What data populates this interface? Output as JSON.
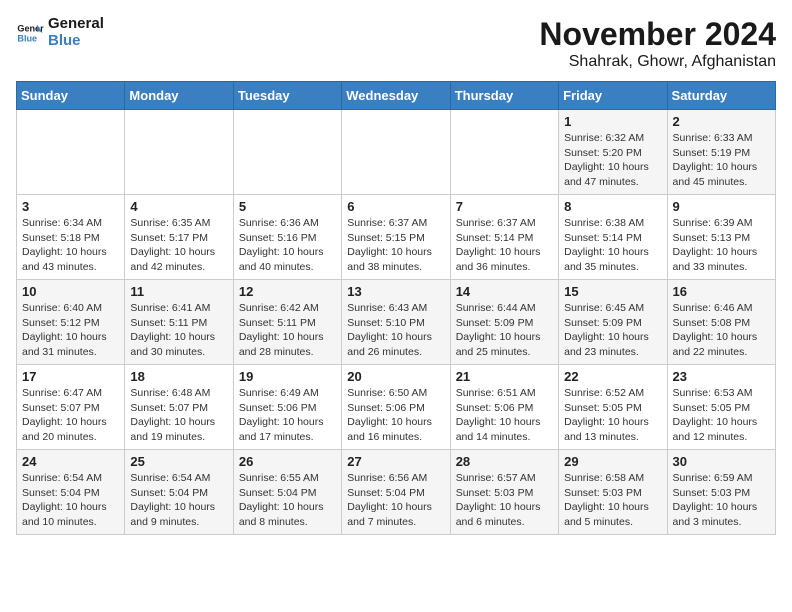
{
  "logo": {
    "line1": "General",
    "line2": "Blue"
  },
  "title": "November 2024",
  "subtitle": "Shahrak, Ghowr, Afghanistan",
  "days_of_week": [
    "Sunday",
    "Monday",
    "Tuesday",
    "Wednesday",
    "Thursday",
    "Friday",
    "Saturday"
  ],
  "weeks": [
    [
      {
        "day": "",
        "info": ""
      },
      {
        "day": "",
        "info": ""
      },
      {
        "day": "",
        "info": ""
      },
      {
        "day": "",
        "info": ""
      },
      {
        "day": "",
        "info": ""
      },
      {
        "day": "1",
        "info": "Sunrise: 6:32 AM\nSunset: 5:20 PM\nDaylight: 10 hours and 47 minutes."
      },
      {
        "day": "2",
        "info": "Sunrise: 6:33 AM\nSunset: 5:19 PM\nDaylight: 10 hours and 45 minutes."
      }
    ],
    [
      {
        "day": "3",
        "info": "Sunrise: 6:34 AM\nSunset: 5:18 PM\nDaylight: 10 hours and 43 minutes."
      },
      {
        "day": "4",
        "info": "Sunrise: 6:35 AM\nSunset: 5:17 PM\nDaylight: 10 hours and 42 minutes."
      },
      {
        "day": "5",
        "info": "Sunrise: 6:36 AM\nSunset: 5:16 PM\nDaylight: 10 hours and 40 minutes."
      },
      {
        "day": "6",
        "info": "Sunrise: 6:37 AM\nSunset: 5:15 PM\nDaylight: 10 hours and 38 minutes."
      },
      {
        "day": "7",
        "info": "Sunrise: 6:37 AM\nSunset: 5:14 PM\nDaylight: 10 hours and 36 minutes."
      },
      {
        "day": "8",
        "info": "Sunrise: 6:38 AM\nSunset: 5:14 PM\nDaylight: 10 hours and 35 minutes."
      },
      {
        "day": "9",
        "info": "Sunrise: 6:39 AM\nSunset: 5:13 PM\nDaylight: 10 hours and 33 minutes."
      }
    ],
    [
      {
        "day": "10",
        "info": "Sunrise: 6:40 AM\nSunset: 5:12 PM\nDaylight: 10 hours and 31 minutes."
      },
      {
        "day": "11",
        "info": "Sunrise: 6:41 AM\nSunset: 5:11 PM\nDaylight: 10 hours and 30 minutes."
      },
      {
        "day": "12",
        "info": "Sunrise: 6:42 AM\nSunset: 5:11 PM\nDaylight: 10 hours and 28 minutes."
      },
      {
        "day": "13",
        "info": "Sunrise: 6:43 AM\nSunset: 5:10 PM\nDaylight: 10 hours and 26 minutes."
      },
      {
        "day": "14",
        "info": "Sunrise: 6:44 AM\nSunset: 5:09 PM\nDaylight: 10 hours and 25 minutes."
      },
      {
        "day": "15",
        "info": "Sunrise: 6:45 AM\nSunset: 5:09 PM\nDaylight: 10 hours and 23 minutes."
      },
      {
        "day": "16",
        "info": "Sunrise: 6:46 AM\nSunset: 5:08 PM\nDaylight: 10 hours and 22 minutes."
      }
    ],
    [
      {
        "day": "17",
        "info": "Sunrise: 6:47 AM\nSunset: 5:07 PM\nDaylight: 10 hours and 20 minutes."
      },
      {
        "day": "18",
        "info": "Sunrise: 6:48 AM\nSunset: 5:07 PM\nDaylight: 10 hours and 19 minutes."
      },
      {
        "day": "19",
        "info": "Sunrise: 6:49 AM\nSunset: 5:06 PM\nDaylight: 10 hours and 17 minutes."
      },
      {
        "day": "20",
        "info": "Sunrise: 6:50 AM\nSunset: 5:06 PM\nDaylight: 10 hours and 16 minutes."
      },
      {
        "day": "21",
        "info": "Sunrise: 6:51 AM\nSunset: 5:06 PM\nDaylight: 10 hours and 14 minutes."
      },
      {
        "day": "22",
        "info": "Sunrise: 6:52 AM\nSunset: 5:05 PM\nDaylight: 10 hours and 13 minutes."
      },
      {
        "day": "23",
        "info": "Sunrise: 6:53 AM\nSunset: 5:05 PM\nDaylight: 10 hours and 12 minutes."
      }
    ],
    [
      {
        "day": "24",
        "info": "Sunrise: 6:54 AM\nSunset: 5:04 PM\nDaylight: 10 hours and 10 minutes."
      },
      {
        "day": "25",
        "info": "Sunrise: 6:54 AM\nSunset: 5:04 PM\nDaylight: 10 hours and 9 minutes."
      },
      {
        "day": "26",
        "info": "Sunrise: 6:55 AM\nSunset: 5:04 PM\nDaylight: 10 hours and 8 minutes."
      },
      {
        "day": "27",
        "info": "Sunrise: 6:56 AM\nSunset: 5:04 PM\nDaylight: 10 hours and 7 minutes."
      },
      {
        "day": "28",
        "info": "Sunrise: 6:57 AM\nSunset: 5:03 PM\nDaylight: 10 hours and 6 minutes."
      },
      {
        "day": "29",
        "info": "Sunrise: 6:58 AM\nSunset: 5:03 PM\nDaylight: 10 hours and 5 minutes."
      },
      {
        "day": "30",
        "info": "Sunrise: 6:59 AM\nSunset: 5:03 PM\nDaylight: 10 hours and 3 minutes."
      }
    ]
  ]
}
